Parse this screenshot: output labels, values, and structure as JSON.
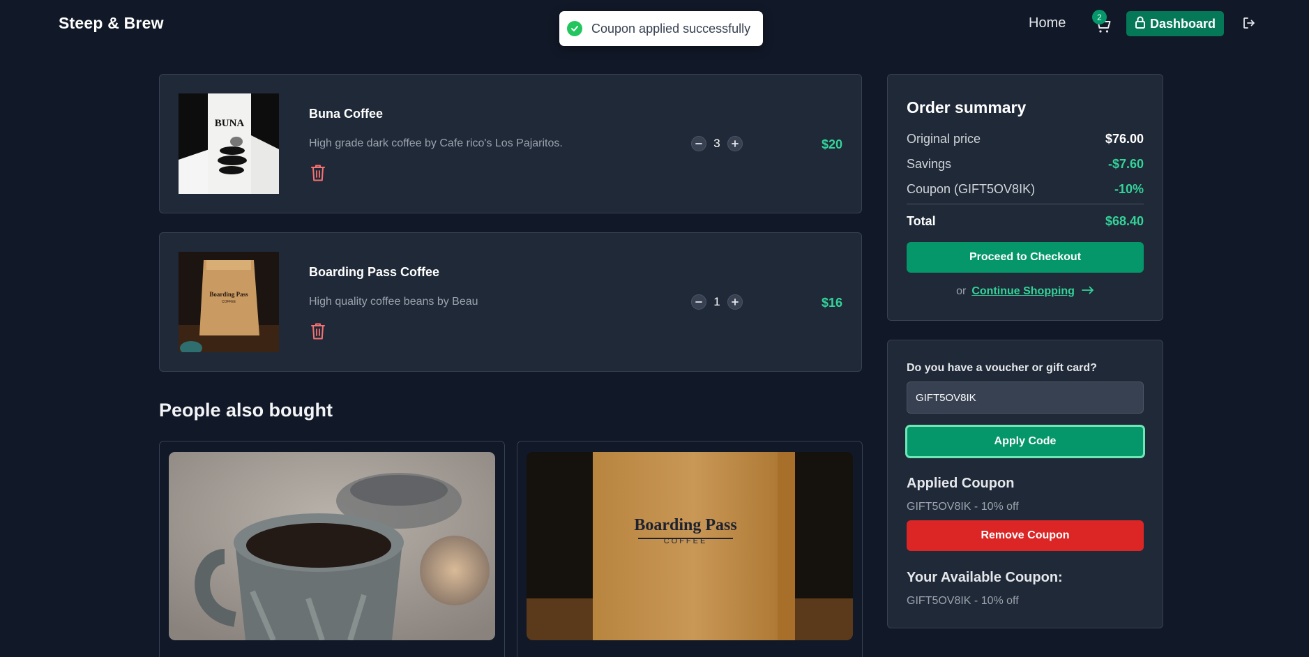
{
  "header": {
    "brand": "Steep & Brew",
    "nav_home": "Home",
    "cart_count": "2",
    "dashboard_label": "Dashboard"
  },
  "toast": {
    "message": "Coupon applied successfully"
  },
  "cart": {
    "items": [
      {
        "name": "Buna Coffee",
        "description": "High grade dark coffee by Cafe rico's Los Pajaritos.",
        "quantity": "3",
        "price": "$20"
      },
      {
        "name": "Boarding Pass Coffee",
        "description": "High quality coffee beans by Beau",
        "quantity": "1",
        "price": "$16"
      }
    ]
  },
  "people_also_bought": {
    "title": "People also bought"
  },
  "summary": {
    "title": "Order summary",
    "original_label": "Original price",
    "original_value": "$76.00",
    "savings_label": "Savings",
    "savings_value": "-$7.60",
    "coupon_label": "Coupon (GIFT5OV8IK)",
    "coupon_value": "-10%",
    "total_label": "Total",
    "total_value": "$68.40",
    "checkout_label": "Proceed to Checkout",
    "or_text": "or",
    "continue_label": "Continue Shopping"
  },
  "voucher": {
    "label": "Do you have a voucher or gift card?",
    "input_value": "GIFT5OV8IK",
    "apply_label": "Apply Code",
    "applied_title": "Applied Coupon",
    "applied_text": "GIFT5OV8IK - 10% off",
    "remove_label": "Remove Coupon",
    "available_title": "Your Available Coupon:",
    "available_text": "GIFT5OV8IK - 10% off"
  },
  "colors": {
    "background": "#111827",
    "card": "#1f2937",
    "accent": "#059669",
    "price": "#34d399",
    "danger": "#dc2626"
  }
}
